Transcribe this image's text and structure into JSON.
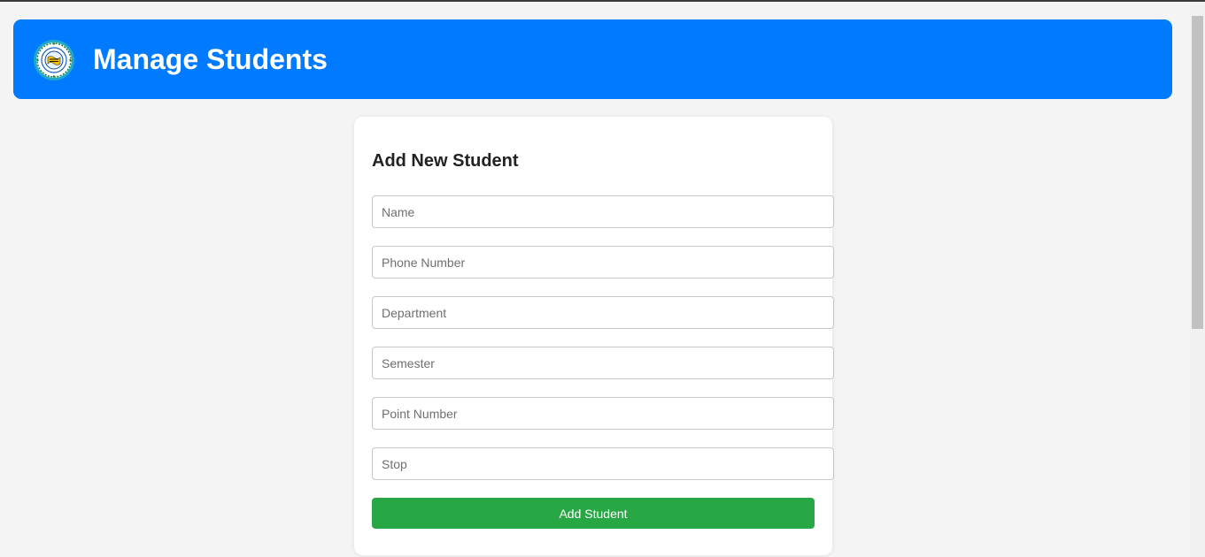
{
  "header": {
    "title": "Manage Students",
    "logo_icon": "university-seal-icon",
    "color": "#007bff"
  },
  "form": {
    "title": "Add New Student",
    "fields": {
      "name": {
        "placeholder": "Name",
        "value": ""
      },
      "phone": {
        "placeholder": "Phone Number",
        "value": ""
      },
      "department": {
        "placeholder": "Department",
        "value": ""
      },
      "semester": {
        "placeholder": "Semester",
        "value": ""
      },
      "point": {
        "placeholder": "Point Number",
        "value": ""
      },
      "stop": {
        "placeholder": "Stop",
        "value": ""
      }
    },
    "submit_label": "Add Student",
    "submit_color": "#28a745"
  }
}
